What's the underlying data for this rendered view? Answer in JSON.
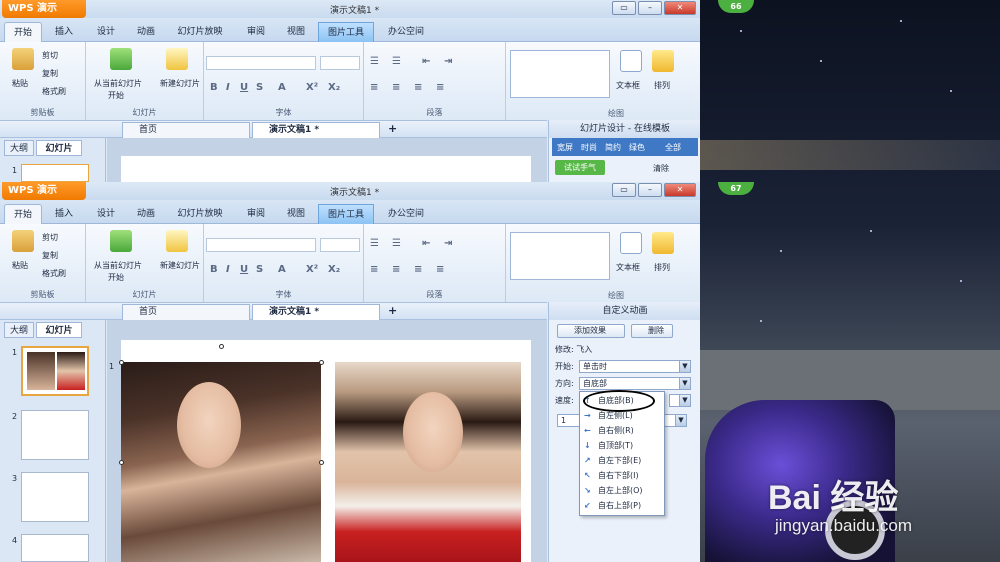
{
  "top": {
    "wps_label": "WPS 演示",
    "window_title": "演示文稿1 *",
    "tabs": [
      "开始",
      "插入",
      "设计",
      "动画",
      "幻灯片放映",
      "审阅",
      "视图",
      "图片工具",
      "办公空间"
    ],
    "clipboard": {
      "paste": "粘贴",
      "cut": "剪切",
      "copy": "复制",
      "format": "格式刷",
      "label": "剪贴板"
    },
    "slides_group": {
      "from_current": "从当前幻灯片",
      "start": "开始",
      "new_slide": "新建幻灯片",
      "label": "幻灯片"
    },
    "font_label": "字体",
    "para_label": "段落",
    "draw_label": "绘图",
    "textbox": "文本框",
    "arrange": "排列",
    "doc_tabs": {
      "home": "首页",
      "doc": "演示文稿1 *"
    },
    "pane_title": "幻灯片设计 - 在线模板",
    "pane_filters": [
      "宽屏",
      "时尚",
      "简约",
      "绿色",
      "全部"
    ],
    "try_btn": "试试手气",
    "clear_btn": "清除",
    "side_tabs": [
      "大纲",
      "幻灯片"
    ],
    "thumb_nums": [
      "1"
    ],
    "badge": "66"
  },
  "bottom": {
    "wps_label": "WPS 演示",
    "window_title": "演示文稿1 *",
    "tabs": [
      "开始",
      "插入",
      "设计",
      "动画",
      "幻灯片放映",
      "审阅",
      "视图",
      "图片工具",
      "办公空间"
    ],
    "clipboard": {
      "paste": "粘贴",
      "cut": "剪切",
      "copy": "复制",
      "format": "格式刷",
      "label": "剪贴板"
    },
    "slides_group": {
      "from_current": "从当前幻灯片",
      "start": "开始",
      "new_slide": "新建幻灯片",
      "label": "幻灯片"
    },
    "font_label": "字体",
    "para_label": "段落",
    "draw_label": "绘图",
    "textbox": "文本框",
    "arrange": "排列",
    "doc_tabs": {
      "home": "首页",
      "doc": "演示文稿1 *"
    },
    "pane_title": "自定义动画",
    "add_effect": "添加效果",
    "delete": "删除",
    "modify": "修改: 飞入",
    "start_label": "开始:",
    "start_value": "单击时",
    "direction_label": "方向:",
    "direction_value": "自底部",
    "speed_label": "速度:",
    "list_num": "1",
    "side_tabs": [
      "大纲",
      "幻灯片"
    ],
    "thumb_nums": [
      "1",
      "2",
      "3",
      "4"
    ],
    "slide_mark": "1",
    "badge": "67",
    "menu": [
      "自底部(B)",
      "自左侧(L)",
      "自右侧(R)",
      "自顶部(T)",
      "自左下部(E)",
      "自右下部(I)",
      "自左上部(O)",
      "自右上部(P)"
    ]
  },
  "watermark": {
    "logo": "Bai 经验",
    "url": "jingyan.baidu.com"
  }
}
